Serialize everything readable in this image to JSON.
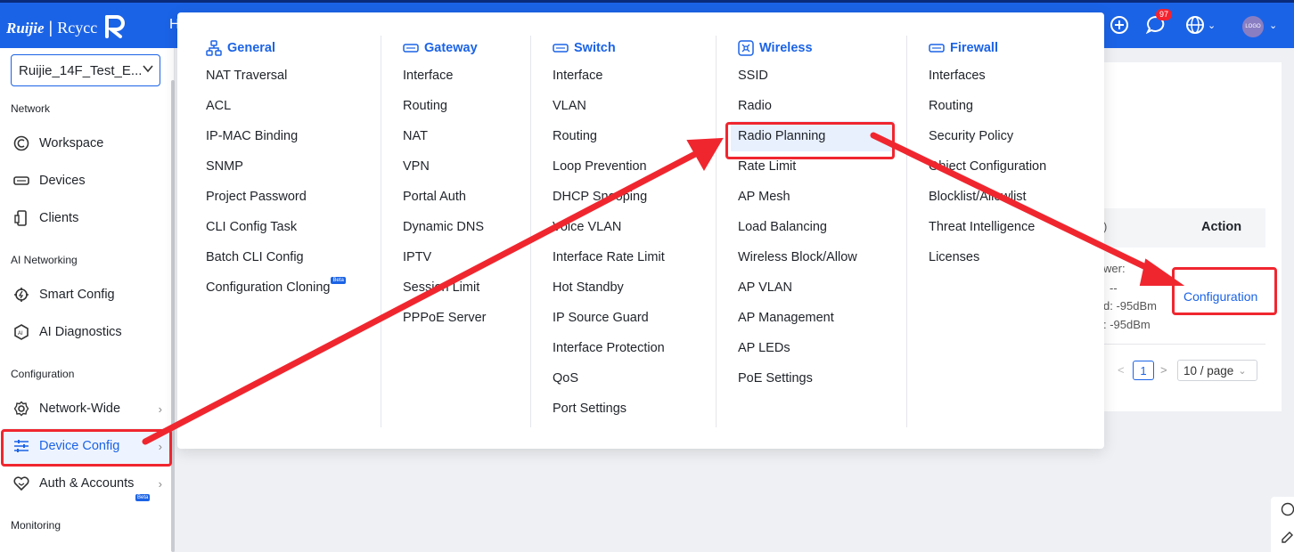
{
  "topbar": {
    "brand": "Ruijie",
    "product": "Rcycc",
    "cut_off_label": "H",
    "notification_count": "97",
    "avatar_text": "LOGO",
    "colors": {
      "bar": "#1b63e6",
      "accent": "#1b63e6"
    }
  },
  "sidebar": {
    "project": "Ruijie_14F_Test_E...",
    "sections": [
      {
        "title": "Network",
        "items": [
          {
            "label": "Workspace",
            "icon": "workspace-icon"
          },
          {
            "label": "Devices",
            "icon": "devices-icon"
          },
          {
            "label": "Clients",
            "icon": "clients-icon"
          }
        ]
      },
      {
        "title": "AI Networking",
        "items": [
          {
            "label": "Smart Config",
            "icon": "smart-config-icon"
          },
          {
            "label": "AI Diagnostics",
            "icon": "ai-diagnostics-icon"
          }
        ]
      },
      {
        "title": "Configuration",
        "items": [
          {
            "label": "Network-Wide",
            "icon": "gear-icon"
          },
          {
            "label": "Device Config",
            "icon": "sliders-icon"
          },
          {
            "label": "Auth & Accounts",
            "icon": "heart-shield-icon"
          }
        ]
      },
      {
        "title": "Monitoring",
        "items": []
      }
    ],
    "beta": "Beta"
  },
  "mega_menu": {
    "columns": [
      {
        "title": "General",
        "icon": "network-topology-icon",
        "items": [
          "NAT Traversal",
          "ACL",
          "IP-MAC Binding",
          "SNMP",
          "Project Password",
          "CLI Config Task",
          "Batch CLI Config",
          "Configuration Cloning"
        ],
        "beta_on": "Configuration Cloning",
        "beta": "Beta"
      },
      {
        "title": "Gateway",
        "icon": "gateway-icon",
        "items": [
          "Interface",
          "Routing",
          "NAT",
          "VPN",
          "Portal Auth",
          "Dynamic DNS",
          "IPTV",
          "Session Limit",
          "PPPoE Server"
        ]
      },
      {
        "title": "Switch",
        "icon": "switch-icon",
        "items": [
          "Interface",
          "VLAN",
          "Routing",
          "Loop Prevention",
          "DHCP Snooping",
          "Voice VLAN",
          "Interface Rate Limit",
          "Hot Standby",
          "IP Source Guard",
          "Interface Protection",
          "QoS",
          "Port Settings"
        ]
      },
      {
        "title": "Wireless",
        "icon": "wireless-icon",
        "items": [
          "SSID",
          "Radio",
          "Radio Planning",
          "Rate Limit",
          "AP Mesh",
          "Load Balancing",
          "Wireless Block/Allow",
          "AP VLAN",
          "AP Management",
          "AP LEDs",
          "PoE Settings"
        ],
        "selected": "Radio Planning"
      },
      {
        "title": "Firewall",
        "icon": "firewall-icon",
        "items": [
          "Interfaces",
          "Routing",
          "Security Policy",
          "Object Configuration",
          "Blocklist/Allowlist",
          "Threat Intelligence",
          "Licenses"
        ]
      }
    ]
  },
  "background": {
    "table_head_partial": ")",
    "action_header": "Action",
    "row_fragments": [
      "wer: ",
      "--",
      "d: -95dBm",
      ": -95dBm"
    ],
    "config_link": "Configuration",
    "page_prev": "<",
    "page": "1",
    "page_next": ">",
    "page_size": "10 / page"
  },
  "annotation_color": "#f0262f"
}
